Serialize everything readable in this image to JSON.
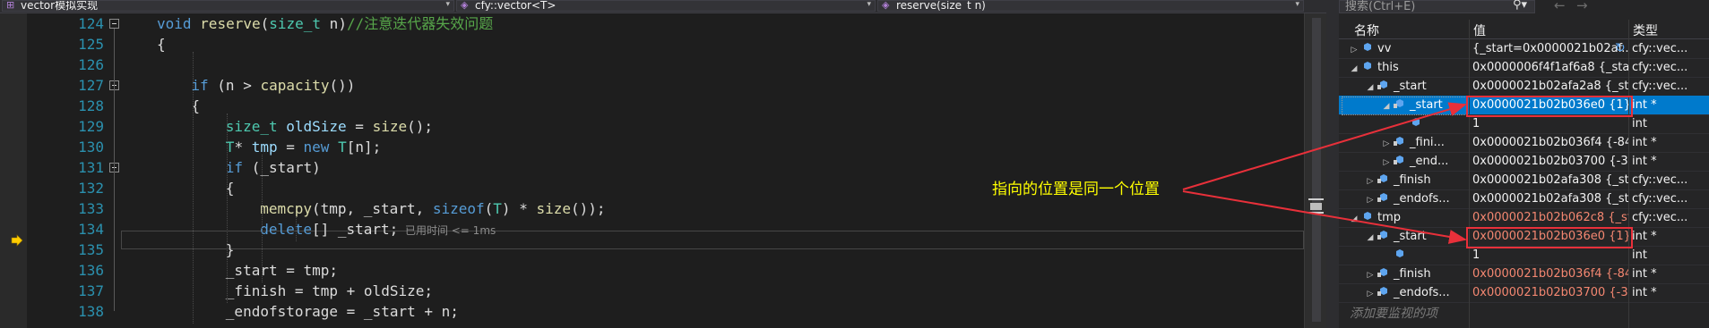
{
  "nav": {
    "file_scope": "vector模拟实现",
    "class_scope": "cfy::vector<T>",
    "member_scope": "reserve(size_t n)"
  },
  "editor": {
    "lines": [
      {
        "num": "124",
        "tokens": [
          {
            "t": "void ",
            "c": "kw"
          },
          {
            "t": "reserve",
            "c": "fn"
          },
          {
            "t": "(",
            "c": ""
          },
          {
            "t": "size_t",
            "c": "typ"
          },
          {
            "t": " n)",
            "c": ""
          },
          {
            "t": "//注意迭代器失效问题",
            "c": "cm"
          }
        ]
      },
      {
        "num": "125",
        "tokens": [
          {
            "t": "{",
            "c": ""
          }
        ]
      },
      {
        "num": "126",
        "tokens": []
      },
      {
        "num": "127",
        "tokens": [
          {
            "t": "if",
            "c": "kw"
          },
          {
            "t": " (n > ",
            "c": ""
          },
          {
            "t": "capacity",
            "c": "fn"
          },
          {
            "t": "())",
            "c": ""
          }
        ]
      },
      {
        "num": "128",
        "tokens": [
          {
            "t": "{",
            "c": ""
          }
        ]
      },
      {
        "num": "129",
        "tokens": [
          {
            "t": "size_t",
            "c": "typ"
          },
          {
            "t": " ",
            "c": ""
          },
          {
            "t": "oldSize",
            "c": "var"
          },
          {
            "t": " = ",
            "c": ""
          },
          {
            "t": "size",
            "c": "fn"
          },
          {
            "t": "();",
            "c": ""
          }
        ]
      },
      {
        "num": "130",
        "tokens": [
          {
            "t": "T",
            "c": "typ"
          },
          {
            "t": "* ",
            "c": ""
          },
          {
            "t": "tmp",
            "c": "var"
          },
          {
            "t": " = ",
            "c": ""
          },
          {
            "t": "new",
            "c": "kw"
          },
          {
            "t": " ",
            "c": ""
          },
          {
            "t": "T",
            "c": "typ"
          },
          {
            "t": "[n];",
            "c": ""
          }
        ]
      },
      {
        "num": "131",
        "tokens": [
          {
            "t": "if",
            "c": "kw"
          },
          {
            "t": " (_start)",
            "c": ""
          }
        ]
      },
      {
        "num": "132",
        "tokens": [
          {
            "t": "{",
            "c": ""
          }
        ]
      },
      {
        "num": "133",
        "tokens": [
          {
            "t": "memcpy",
            "c": "fn"
          },
          {
            "t": "(tmp, _start, ",
            "c": ""
          },
          {
            "t": "sizeof",
            "c": "kw"
          },
          {
            "t": "(",
            "c": ""
          },
          {
            "t": "T",
            "c": "typ"
          },
          {
            "t": ") * ",
            "c": ""
          },
          {
            "t": "size",
            "c": "fn"
          },
          {
            "t": "());",
            "c": ""
          }
        ]
      },
      {
        "num": "134",
        "tokens": [
          {
            "t": "delete",
            "c": "kw"
          },
          {
            "t": "[] _start;",
            "c": ""
          }
        ]
      },
      {
        "num": "135",
        "tokens": [
          {
            "t": "}",
            "c": ""
          }
        ]
      },
      {
        "num": "136",
        "tokens": [
          {
            "t": "_start = tmp;",
            "c": ""
          }
        ]
      },
      {
        "num": "137",
        "tokens": [
          {
            "t": "_finish = tmp + oldSize;",
            "c": ""
          }
        ]
      },
      {
        "num": "138",
        "tokens": [
          {
            "t": "_endofstorage = _start + n;",
            "c": ""
          }
        ]
      }
    ],
    "elapsed_hint": "已用时间 <= 1ms"
  },
  "watch": {
    "search_placeholder": "搜索(Ctrl+E)",
    "col_name": "名称",
    "col_value": "值",
    "col_type": "类型",
    "rows": [
      {
        "name": "vv",
        "value": "{_start=0x0000021b02af...",
        "type": "cfy::vec..."
      },
      {
        "name": "this",
        "value": "0x0000006f4f1af6a8 {_start...",
        "type": "cfy::vec..."
      },
      {
        "name": "_start",
        "value": "0x0000021b02afa2a8 {_sta...",
        "type": "cfy::vec..."
      },
      {
        "name": "_start",
        "value": "0x0000021b02b036e0 {1}",
        "type": "int *"
      },
      {
        "name": "",
        "value": "1",
        "type": "int"
      },
      {
        "name": "_fini...",
        "value": "0x0000021b02b036f4 {-84...",
        "type": "int *"
      },
      {
        "name": "_end...",
        "value": "0x0000021b02b03700 {-33...",
        "type": "int *"
      },
      {
        "name": "_finish",
        "value": "0x0000021b02afa308 {_sta...",
        "type": "cfy::vec..."
      },
      {
        "name": "_endofs...",
        "value": "0x0000021b02afa308 {_sta...",
        "type": "cfy::vec..."
      },
      {
        "name": "tmp",
        "value": "0x0000021b02b062c8 {_sta...",
        "type": "cfy::vec..."
      },
      {
        "name": "_start",
        "value": "0x0000021b02b036e0 {1}",
        "type": "int *"
      },
      {
        "name": "",
        "value": "1",
        "type": "int"
      },
      {
        "name": "_finish",
        "value": "0x0000021b02b036f4 {-84...",
        "type": "int *"
      },
      {
        "name": "_endofs...",
        "value": "0x0000021b02b03700 {-33...",
        "type": "int *"
      }
    ],
    "add_watch": "添加要监视的项"
  },
  "annotation": "指向的位置是同一个位置",
  "colors": {
    "accent": "#007acc",
    "annotation": "#ffff00",
    "highlight": "#e8303a",
    "changed_value": "#f48771"
  }
}
